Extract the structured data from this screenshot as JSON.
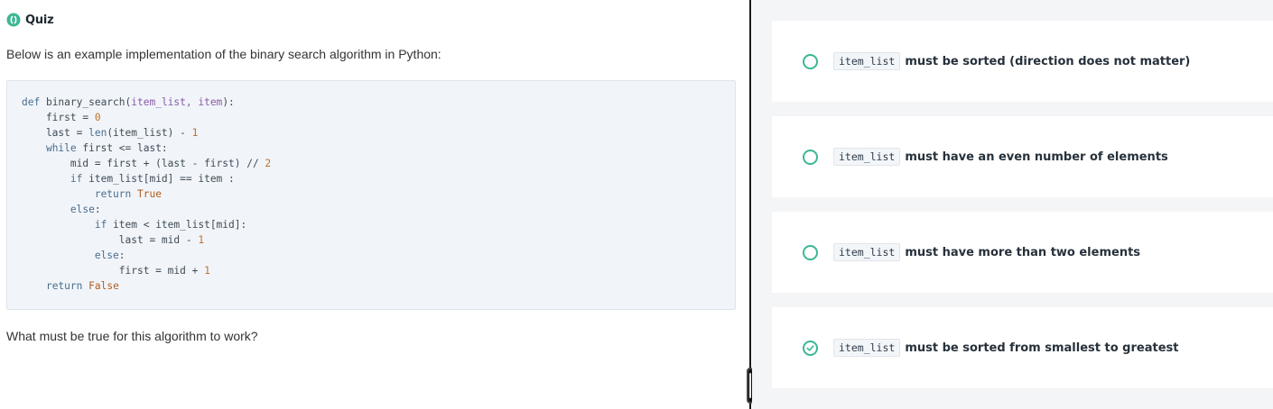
{
  "quiz": {
    "title": "Quiz",
    "intro": "Below is an example implementation of the binary search algorithm in Python:",
    "question": "What must be true for this algorithm to work?"
  },
  "code": {
    "lines": [
      "def binary_search(item_list, item):",
      "    first = 0",
      "    last = len(item_list) - 1",
      "    while first <= last:",
      "        mid = first + (last - first) // 2",
      "        if item_list[mid] == item :",
      "            return True",
      "        else:",
      "            if item < item_list[mid]:",
      "                last = mid - 1",
      "            else:",
      "                first = mid + 1",
      "    return False"
    ]
  },
  "options": [
    {
      "code": "item_list",
      "label": "must be sorted (direction does not matter)",
      "checked": false
    },
    {
      "code": "item_list",
      "label": "must have an even number of elements",
      "checked": false
    },
    {
      "code": "item_list",
      "label": "must have more than two elements",
      "checked": false
    },
    {
      "code": "item_list",
      "label": "must be sorted from smallest to greatest",
      "checked": true
    }
  ],
  "colors": {
    "accent": "#3bb795",
    "divider": "#1a1a1a",
    "panel_bg": "#f4f5f7",
    "code_bg": "#f1f5fa"
  },
  "icons": {
    "quiz": "quiz-icon",
    "radio_empty": "radio-empty-icon",
    "radio_checked": "check-circle-icon"
  }
}
